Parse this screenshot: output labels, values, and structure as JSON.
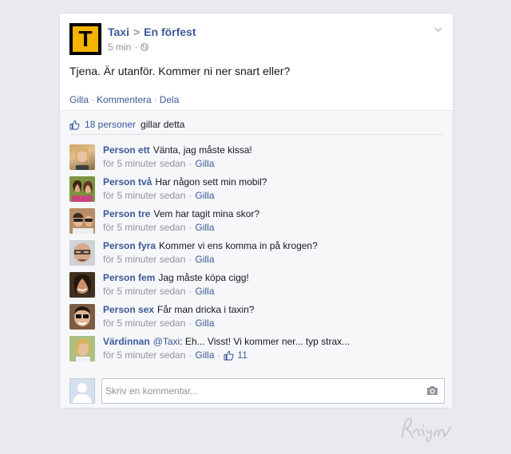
{
  "post": {
    "page_name": "Taxi",
    "separator": ">",
    "event_name": "En förfest",
    "avatar_letter": "T",
    "time": "5 min",
    "dot": "·",
    "text": "Tjena. Är utanför. Kommer ni ner snart eller?",
    "actions": {
      "like": "Gilla",
      "comment": "Kommentera",
      "share": "Dela"
    }
  },
  "likes": {
    "count_label": "18 personer",
    "suffix": "gillar detta"
  },
  "comments": [
    {
      "author": "Person ett",
      "text": "Vänta, jag måste kissa!",
      "time": "för 5 minuter sedan",
      "like": "Gilla"
    },
    {
      "author": "Person två",
      "text": "Har någon sett min mobil?",
      "time": "för 5 minuter sedan",
      "like": "Gilla"
    },
    {
      "author": "Person tre",
      "text": "Vem har tagit mina skor?",
      "time": "för 5 minuter sedan",
      "like": "Gilla"
    },
    {
      "author": "Person fyra",
      "text": "Kommer vi ens komma in på krogen?",
      "time": "för 5 minuter sedan",
      "like": "Gilla"
    },
    {
      "author": "Person fem",
      "text": "Jag måste köpa cigg!",
      "time": "för 5 minuter sedan",
      "like": "Gilla"
    },
    {
      "author": "Person sex",
      "text": "Får man dricka i taxin?",
      "time": "för 5 minuter sedan",
      "like": "Gilla"
    },
    {
      "author": "Värdinnan",
      "mention": "@Taxi",
      "text": ": Eh... Visst! Vi kommer ner... typ strax...",
      "time": "för 5 minuter sedan",
      "like": "Gilla",
      "like_count": "11"
    }
  ],
  "reply": {
    "placeholder": "Skriv en kommentar..."
  },
  "signature": "Reign",
  "colors": {
    "link": "#3b5998",
    "meta": "#90949c",
    "background": "#e9eaed",
    "avatar_bg": "#f5b400"
  },
  "icons": [
    "chevron-down-icon",
    "globe-icon",
    "thumbs-up-icon",
    "camera-icon"
  ]
}
